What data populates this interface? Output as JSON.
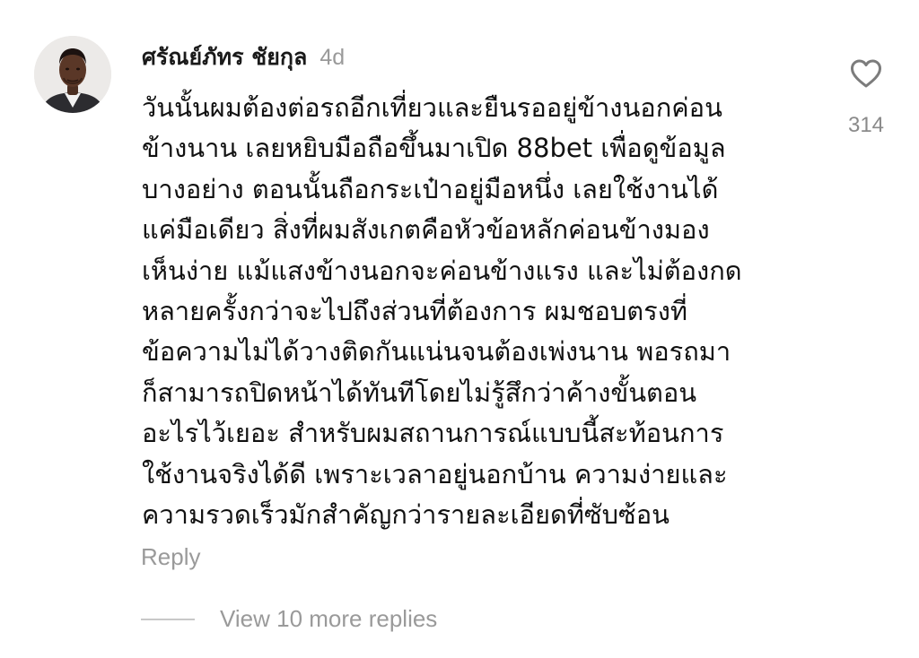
{
  "comment": {
    "author": "ศรัณย์ภัทร ชัยกุล",
    "age": "4d",
    "lines": [
      "วันนั้นผมต้องต่อรถอีกเที่ยวและยืนรออยู่ข้างนอกค่อน",
      "ข้างนาน เลยหยิบมือถือขึ้นมาเปิด 88bet เพื่อดูข้อมูล",
      "บางอย่าง ตอนนั้นถือกระเป๋าอยู่มือหนึ่ง เลยใช้งานได้",
      "แค่มือเดียว สิ่งที่ผมสังเกตคือหัวข้อหลักค่อนข้างมอง",
      "เห็นง่าย แม้แสงข้างนอกจะค่อนข้างแรง และไม่ต้องกด",
      "หลายครั้งกว่าจะไปถึงส่วนที่ต้องการ ผมชอบตรงที่",
      "ข้อความไม่ได้วางติดกันแน่นจนต้องเพ่งนาน พอรถมา",
      "ก็สามารถปิดหน้าได้ทันทีโดยไม่รู้สึกว่าค้างขั้นตอน",
      "อะไรไว้เยอะ สำหรับผมสถานการณ์แบบนี้สะท้อนการ",
      "ใช้งานจริงได้ดี เพราะเวลาอยู่นอกบ้าน ความง่ายและ",
      "ความรวดเร็วมักสำคัญกว่ารายละเอียดที่ซับซ้อน"
    ],
    "reply_label": "Reply",
    "more_replies_label": "View 10 more replies",
    "like_count": "314",
    "like_icon": "heart-outline-icon"
  }
}
